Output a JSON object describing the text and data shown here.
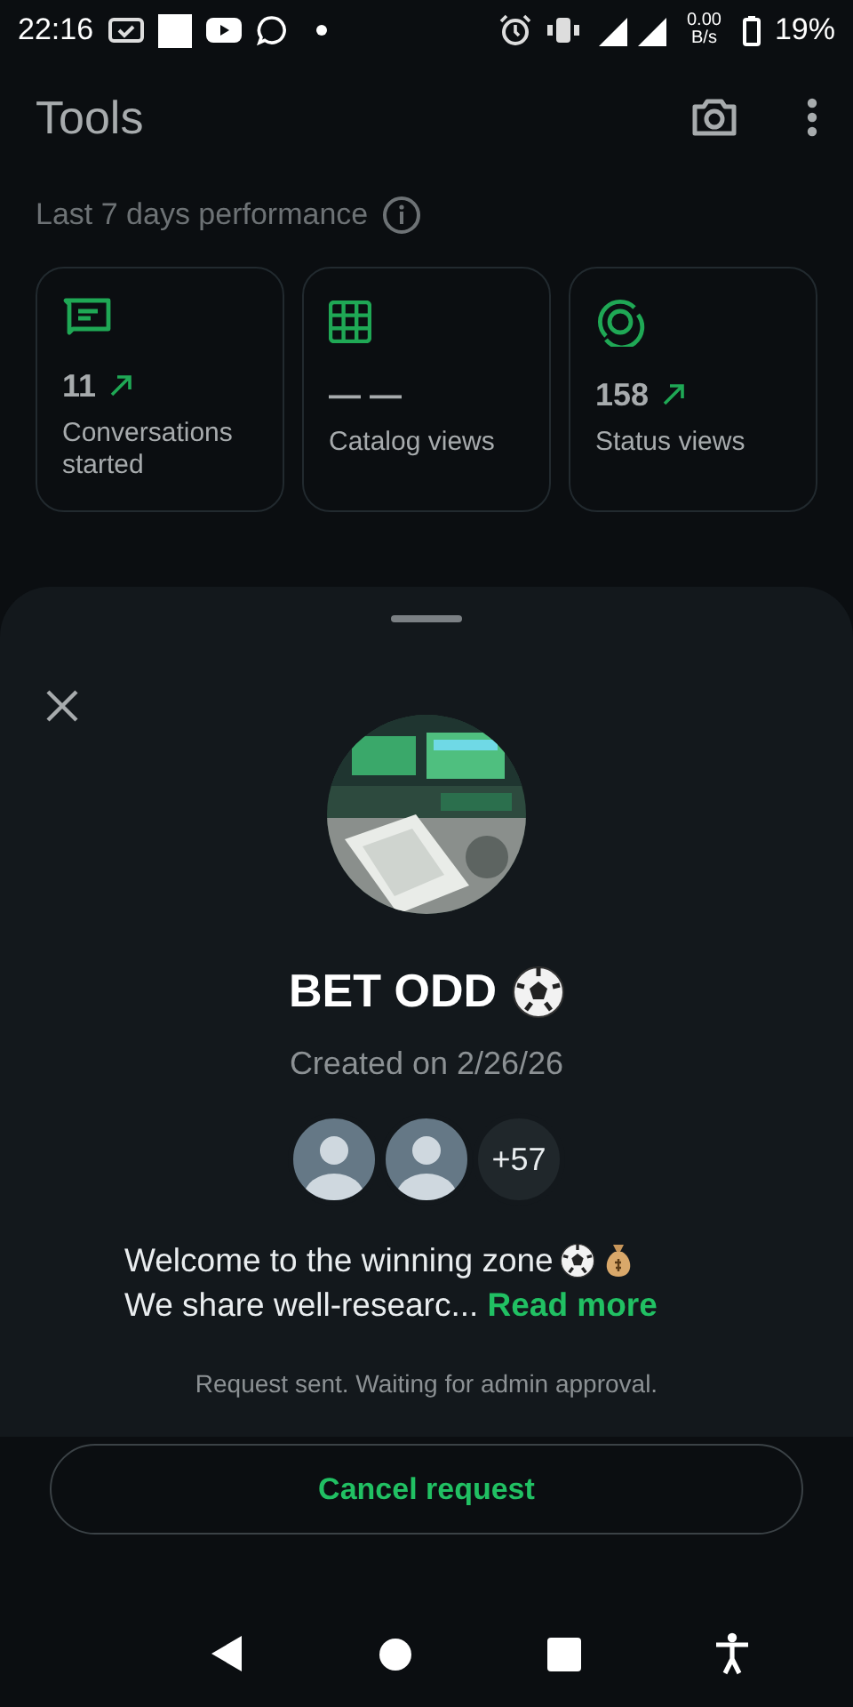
{
  "status_bar": {
    "time": "22:16",
    "net_speed": "0.00",
    "net_unit": "B/s",
    "battery": "19%"
  },
  "header": {
    "title": "Tools"
  },
  "performance": {
    "title": "Last 7 days performance",
    "cards": [
      {
        "kind": "conversations",
        "value": "11",
        "trend_up": true,
        "label": "Conversations started"
      },
      {
        "kind": "catalog",
        "value": "— —",
        "trend_up": false,
        "label": "Catalog views"
      },
      {
        "kind": "status",
        "value": "158",
        "trend_up": true,
        "label": "Status views"
      }
    ]
  },
  "sheet": {
    "group": {
      "name": "BET ODD",
      "created": "Created on 2/26/26",
      "members_more": "+57"
    },
    "description_line1": "Welcome to the winning zone",
    "description_line2": "We share well-researc...",
    "read_more": "Read more",
    "request_note": "Request sent. Waiting for admin approval."
  },
  "cancel_button": "Cancel request"
}
